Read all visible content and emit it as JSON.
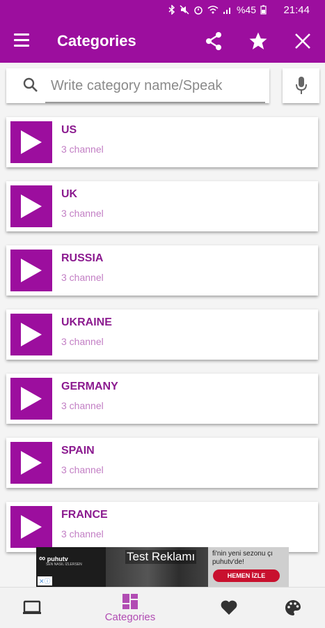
{
  "status_bar": {
    "time": "21:44",
    "battery": "%45"
  },
  "app_bar": {
    "title": "Categories",
    "menu_icon": "hamburger-menu-icon",
    "share_icon": "share-icon",
    "favorite_icon": "star-icon",
    "close_icon": "close-icon"
  },
  "search": {
    "placeholder": "Write category name/Speak",
    "mic_icon": "microphone-icon"
  },
  "categories": [
    {
      "name": "US",
      "count": "3 channel"
    },
    {
      "name": "UK",
      "count": "3 channel"
    },
    {
      "name": "RUSSIA",
      "count": "3 channel"
    },
    {
      "name": "UKRAINE",
      "count": "3 channel"
    },
    {
      "name": "GERMANY",
      "count": "3 channel"
    },
    {
      "name": "SPAIN",
      "count": "3 channel"
    },
    {
      "name": "FRANCE",
      "count": "3 channel"
    }
  ],
  "ad": {
    "label": "Test Reklamı",
    "brand": "puhutv",
    "tagline": "SEN NASIL İZLERSEN",
    "promo": "fi'nin yeni sezonu çı puhutv'de!",
    "cta": "HEMEN İZLE"
  },
  "bottom_nav": {
    "items": [
      {
        "icon": "tv-icon",
        "label": ""
      },
      {
        "icon": "categories-icon",
        "label": "Categories"
      },
      {
        "icon": "heart-icon",
        "label": ""
      },
      {
        "icon": "palette-icon",
        "label": ""
      }
    ],
    "active": "Categories"
  },
  "colors": {
    "primary": "#9c0e9e",
    "title_text": "#8b1a8f",
    "sub_text": "#c27ec4",
    "background": "#f4f4f4"
  }
}
